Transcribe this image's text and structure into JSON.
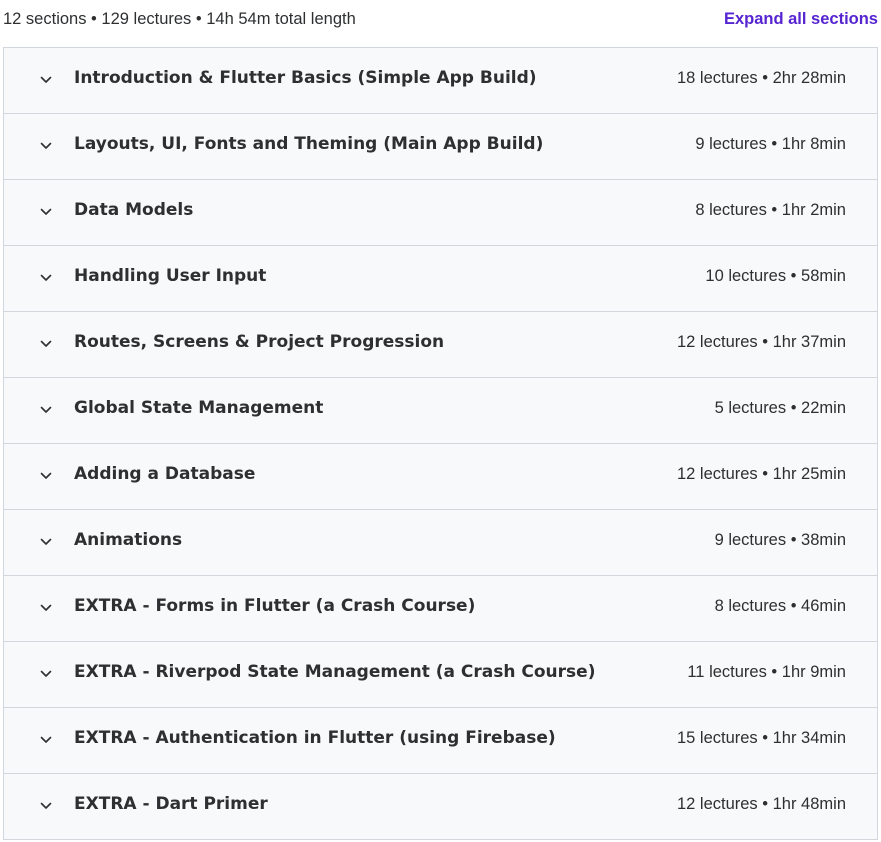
{
  "curriculum": {
    "summary": "12 sections • 129 lectures • 14h 54m total length",
    "expand_label": "Expand all sections",
    "accent_color": "#5624d0",
    "sections": [
      {
        "title": "Introduction & Flutter Basics (Simple App Build)",
        "meta": "18 lectures • 2hr 28min"
      },
      {
        "title": "Layouts, UI, Fonts and Theming (Main App Build)",
        "meta": "9 lectures • 1hr 8min"
      },
      {
        "title": "Data Models",
        "meta": "8 lectures • 1hr 2min"
      },
      {
        "title": "Handling User Input",
        "meta": "10 lectures • 58min"
      },
      {
        "title": "Routes, Screens & Project Progression",
        "meta": "12 lectures • 1hr 37min"
      },
      {
        "title": "Global State Management",
        "meta": "5 lectures • 22min"
      },
      {
        "title": "Adding a Database",
        "meta": "12 lectures • 1hr 25min"
      },
      {
        "title": "Animations",
        "meta": "9 lectures • 38min"
      },
      {
        "title": "EXTRA - Forms in Flutter (a Crash Course)",
        "meta": "8 lectures • 46min"
      },
      {
        "title": "EXTRA - Riverpod State Management (a Crash Course)",
        "meta": "11 lectures • 1hr 9min"
      },
      {
        "title": "EXTRA - Authentication in Flutter (using Firebase)",
        "meta": "15 lectures • 1hr 34min"
      },
      {
        "title": "EXTRA - Dart Primer",
        "meta": "12 lectures • 1hr 48min"
      }
    ],
    "chevron_icon": "chevron-down-icon"
  }
}
